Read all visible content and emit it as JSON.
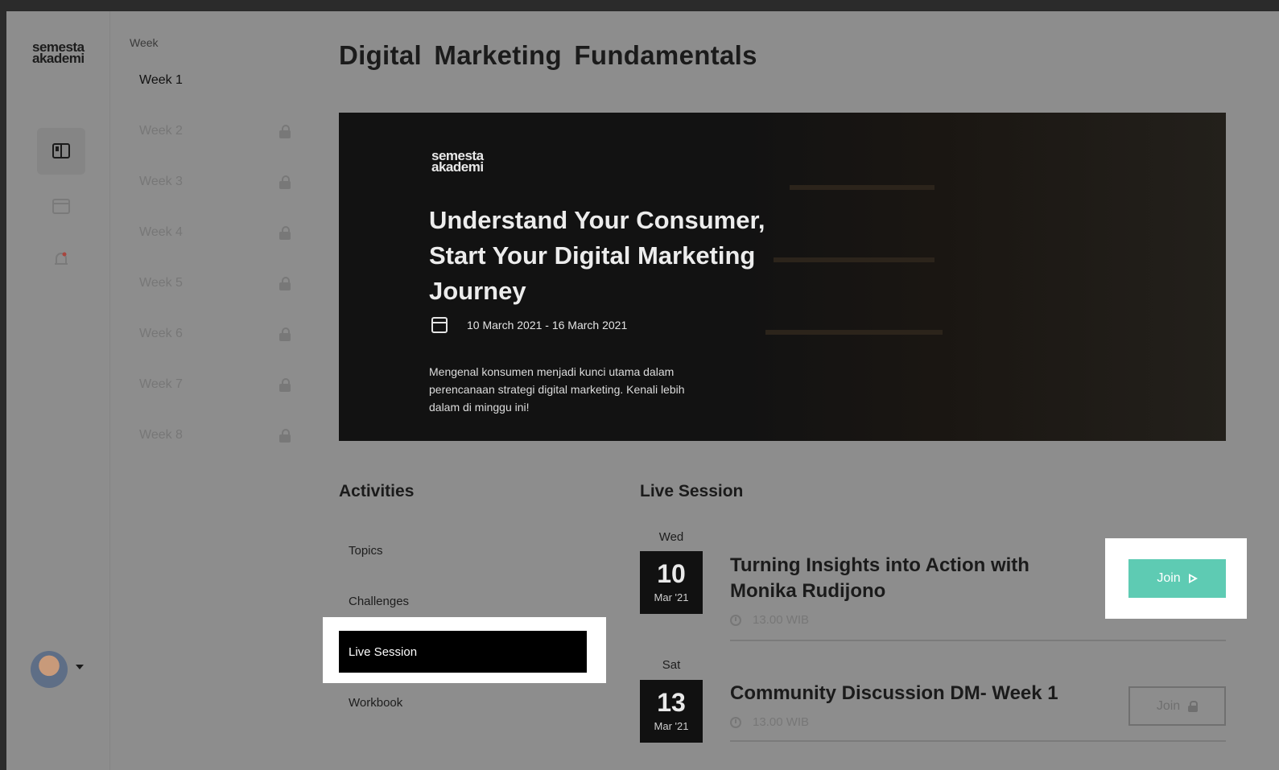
{
  "brand": {
    "logo_line1": "semesta",
    "logo_line2": "akademi"
  },
  "rail": {
    "items": [
      {
        "name": "course-book-icon",
        "active": true
      },
      {
        "name": "calendar-icon",
        "active": false
      },
      {
        "name": "notification-bell-icon",
        "active": false
      }
    ]
  },
  "weeks": {
    "header": "Week",
    "items": [
      {
        "label": "Week 1",
        "locked": false
      },
      {
        "label": "Week 2",
        "locked": true
      },
      {
        "label": "Week 3",
        "locked": true
      },
      {
        "label": "Week 4",
        "locked": true
      },
      {
        "label": "Week 5",
        "locked": true
      },
      {
        "label": "Week 6",
        "locked": true
      },
      {
        "label": "Week 7",
        "locked": true
      },
      {
        "label": "Week 8",
        "locked": true
      }
    ]
  },
  "main": {
    "title": "Digital Marketing  Fundamentals",
    "hero": {
      "logo_line1": "semesta",
      "logo_line2": "akademi",
      "title": "Understand Your Consumer, Start Your Digital Marketing Journey",
      "date_range": "10 March 2021 - 16 March 2021",
      "description": "Mengenal konsumen menjadi kunci utama dalam perencanaan strategi digital marketing. Kenali lebih dalam di minggu ini!"
    }
  },
  "activities": {
    "title": "Activities",
    "items": [
      {
        "label": "Topics",
        "selected": false
      },
      {
        "label": "Challenges",
        "selected": false
      },
      {
        "label": "Live Session",
        "selected": true
      },
      {
        "label": "Workbook",
        "selected": false
      }
    ]
  },
  "live_session": {
    "title": "Live Session",
    "sessions": [
      {
        "day": "Wed",
        "date": "10",
        "month": "Mar '21",
        "title_line1": "Turning Insights into Action with",
        "title_line2": "Monika Rudijono",
        "time": "13.00 WIB",
        "join_label": "Join",
        "locked": false
      },
      {
        "day": "Sat",
        "date": "13",
        "month": "Mar '21",
        "title_line1": "Community Discussion DM- Week 1",
        "title_line2": "",
        "time": "13.00 WIB",
        "join_label": "Join",
        "locked": true
      }
    ]
  },
  "colors": {
    "join_accent": "#5ecbb3",
    "overlay_gray": "#8d8d8d",
    "highlight": "#ffffff"
  }
}
